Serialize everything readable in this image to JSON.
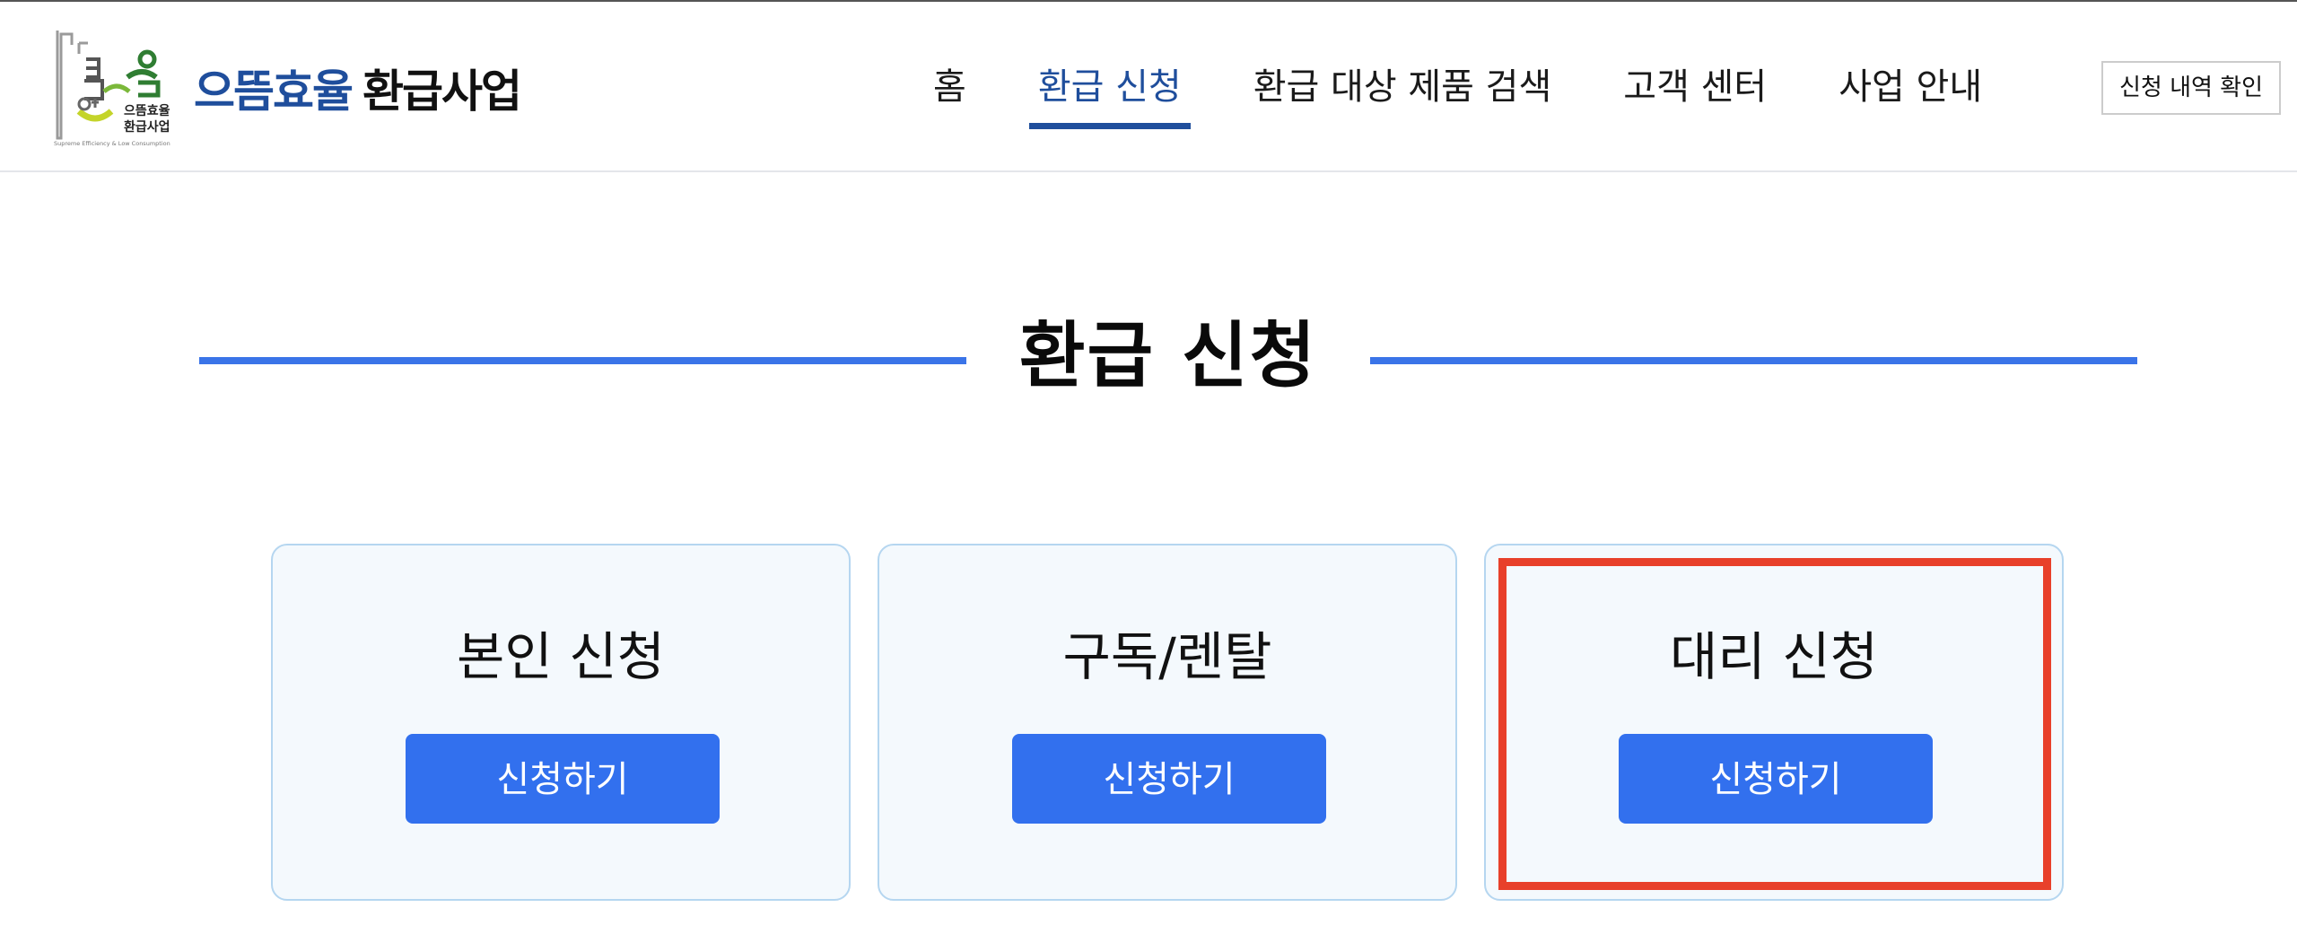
{
  "header": {
    "logo": {
      "brand_blue": "으뜸효율",
      "brand_dark": "환급사업",
      "mark_text_line1": "으뜸효율",
      "mark_text_line2": "환급사업",
      "mark_tagline": "Supreme Efficiency & Low Consumption"
    },
    "nav": [
      {
        "label": "홈",
        "active": false
      },
      {
        "label": "환급 신청",
        "active": true
      },
      {
        "label": "환급 대상 제품 검색",
        "active": false
      },
      {
        "label": "고객 센터",
        "active": false
      },
      {
        "label": "사업 안내",
        "active": false
      }
    ],
    "history_button": "신청 내역 확인"
  },
  "section": {
    "title": "환급 신청"
  },
  "cards": [
    {
      "title": "본인 신청",
      "button": "신청하기",
      "highlighted": false
    },
    {
      "title": "구독/렌탈",
      "button": "신청하기",
      "highlighted": false
    },
    {
      "title": "대리 신청",
      "button": "신청하기",
      "highlighted": true
    }
  ],
  "colors": {
    "brand_blue": "#1f4e9c",
    "accent_blue": "#3270ee",
    "title_line": "#3a74e8",
    "card_bg": "#f4f9fd",
    "card_border": "#b5d6f0",
    "highlight": "#e8402a"
  }
}
